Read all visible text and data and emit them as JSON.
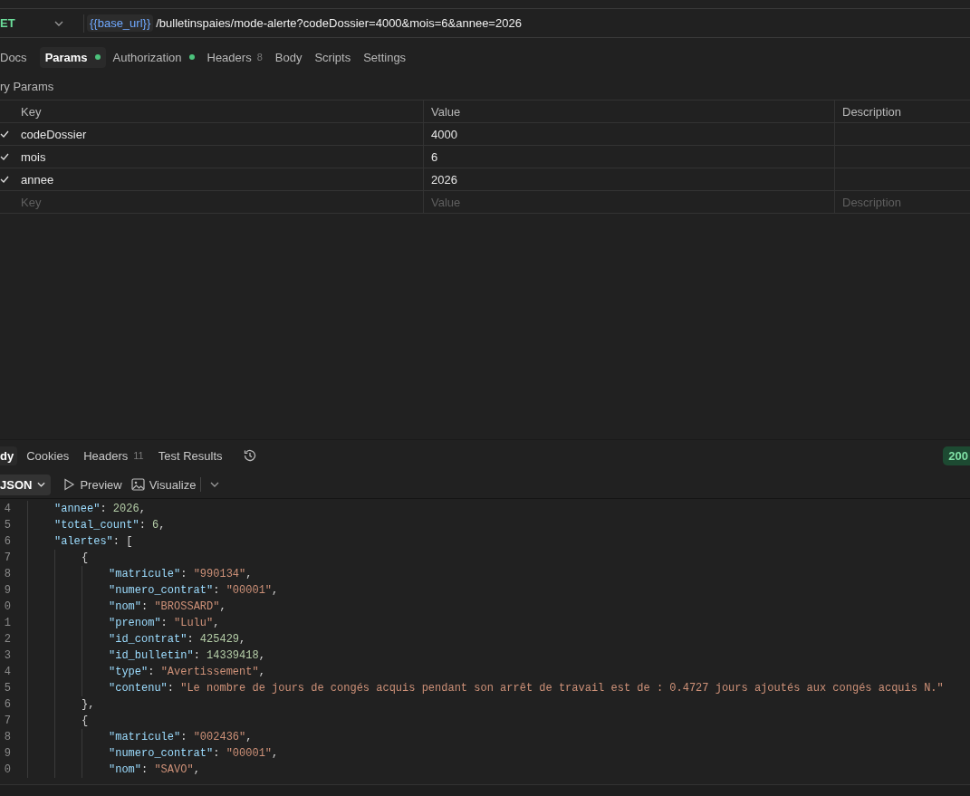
{
  "request": {
    "method": "ET",
    "url_variable": "{{base_url}}",
    "url_path": "/bulletinspaies/mode-alerte?codeDossier=4000&mois=6&annee=2026"
  },
  "request_tabs": [
    {
      "label": "Docs",
      "selected": false
    },
    {
      "label": "Params",
      "selected": true,
      "dot": true
    },
    {
      "label": "Authorization",
      "selected": false,
      "dot": true
    },
    {
      "label": "Headers",
      "count": "8",
      "selected": false
    },
    {
      "label": "Body",
      "selected": false
    },
    {
      "label": "Scripts",
      "selected": false
    },
    {
      "label": "Settings",
      "selected": false
    }
  ],
  "params": {
    "title": "ry Params",
    "columns": [
      "Key",
      "Value",
      "Description"
    ],
    "rows": [
      {
        "checked": true,
        "key": "codeDossier",
        "value": "4000"
      },
      {
        "checked": true,
        "key": "mois",
        "value": "6"
      },
      {
        "checked": true,
        "key": "annee",
        "value": "2026"
      }
    ],
    "new_row": {
      "key_placeholder": "Key",
      "value_placeholder": "Value",
      "description_placeholder": "Description"
    }
  },
  "response_tabs": [
    {
      "label": "dy",
      "selected": true
    },
    {
      "label": "Cookies",
      "selected": false
    },
    {
      "label": "Headers",
      "count": "11",
      "selected": false
    },
    {
      "label": "Test Results",
      "selected": false
    }
  ],
  "status": "200",
  "format": "JSON",
  "view_buttons": [
    "Preview",
    "Visualize"
  ],
  "code_lines": [
    {
      "number": "4",
      "tokens": [
        {
          "kind": "key",
          "text": "\"annee\""
        },
        {
          "kind": "punct",
          "text": ": "
        },
        {
          "kind": "number",
          "text": "2026"
        },
        {
          "kind": "punct",
          "text": ","
        }
      ]
    },
    {
      "number": "5",
      "tokens": [
        {
          "kind": "key",
          "text": "\"total_count\""
        },
        {
          "kind": "punct",
          "text": ": "
        },
        {
          "kind": "number",
          "text": "6"
        },
        {
          "kind": "punct",
          "text": ","
        }
      ]
    },
    {
      "number": "6",
      "tokens": [
        {
          "kind": "key",
          "text": "\"alertes\""
        },
        {
          "kind": "punct",
          "text": ": ["
        }
      ],
      "children": [
        {
          "number": "7",
          "tokens": [
            {
              "kind": "punct",
              "text": "{"
            }
          ],
          "children": [
            {
              "number": "8",
              "tokens": [
                {
                  "kind": "key",
                  "text": "\"matricule\""
                },
                {
                  "kind": "punct",
                  "text": ": "
                },
                {
                  "kind": "string",
                  "text": "\"990134\""
                },
                {
                  "kind": "punct",
                  "text": ","
                }
              ]
            },
            {
              "number": "9",
              "tokens": [
                {
                  "kind": "key",
                  "text": "\"numero_contrat\""
                },
                {
                  "kind": "punct",
                  "text": ": "
                },
                {
                  "kind": "string",
                  "text": "\"00001\""
                },
                {
                  "kind": "punct",
                  "text": ","
                }
              ]
            },
            {
              "number": "0",
              "tokens": [
                {
                  "kind": "key",
                  "text": "\"nom\""
                },
                {
                  "kind": "punct",
                  "text": ": "
                },
                {
                  "kind": "string",
                  "text": "\"BROSSARD\""
                },
                {
                  "kind": "punct",
                  "text": ","
                }
              ]
            },
            {
              "number": "1",
              "tokens": [
                {
                  "kind": "key",
                  "text": "\"prenom\""
                },
                {
                  "kind": "punct",
                  "text": ": "
                },
                {
                  "kind": "string",
                  "text": "\"Lulu\""
                },
                {
                  "kind": "punct",
                  "text": ","
                }
              ]
            },
            {
              "number": "2",
              "tokens": [
                {
                  "kind": "key",
                  "text": "\"id_contrat\""
                },
                {
                  "kind": "punct",
                  "text": ": "
                },
                {
                  "kind": "number",
                  "text": "425429"
                },
                {
                  "kind": "punct",
                  "text": ","
                }
              ]
            },
            {
              "number": "3",
              "tokens": [
                {
                  "kind": "key",
                  "text": "\"id_bulletin\""
                },
                {
                  "kind": "punct",
                  "text": ": "
                },
                {
                  "kind": "number",
                  "text": "14339418"
                },
                {
                  "kind": "punct",
                  "text": ","
                }
              ]
            },
            {
              "number": "4",
              "tokens": [
                {
                  "kind": "key",
                  "text": "\"type\""
                },
                {
                  "kind": "punct",
                  "text": ": "
                },
                {
                  "kind": "string",
                  "text": "\"Avertissement\""
                },
                {
                  "kind": "punct",
                  "text": ","
                }
              ]
            },
            {
              "number": "5",
              "tokens": [
                {
                  "kind": "key",
                  "text": "\"contenu\""
                },
                {
                  "kind": "punct",
                  "text": ": "
                },
                {
                  "kind": "string",
                  "text": "\"Le nombre de jours de congés acquis pendant son arrêt de travail est de : 0.4727 jours ajoutés aux congés acquis N.\""
                }
              ]
            }
          ]
        },
        {
          "number": "6",
          "tokens": [
            {
              "kind": "punct",
              "text": "},"
            }
          ]
        },
        {
          "number": "7",
          "tokens": [
            {
              "kind": "punct",
              "text": "{"
            }
          ],
          "children": [
            {
              "number": "8",
              "tokens": [
                {
                  "kind": "key",
                  "text": "\"matricule\""
                },
                {
                  "kind": "punct",
                  "text": ": "
                },
                {
                  "kind": "string",
                  "text": "\"002436\""
                },
                {
                  "kind": "punct",
                  "text": ","
                }
              ]
            },
            {
              "number": "9",
              "tokens": [
                {
                  "kind": "key",
                  "text": "\"numero_contrat\""
                },
                {
                  "kind": "punct",
                  "text": ": "
                },
                {
                  "kind": "string",
                  "text": "\"00001\""
                },
                {
                  "kind": "punct",
                  "text": ","
                }
              ]
            },
            {
              "number": "0",
              "tokens": [
                {
                  "kind": "key",
                  "text": "\"nom\""
                },
                {
                  "kind": "punct",
                  "text": ": "
                },
                {
                  "kind": "string",
                  "text": "\"SAVO\""
                },
                {
                  "kind": "punct",
                  "text": ","
                }
              ]
            }
          ]
        }
      ]
    }
  ]
}
